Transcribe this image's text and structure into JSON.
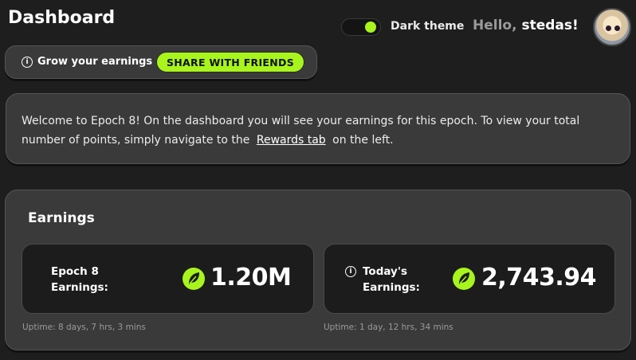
{
  "header": {
    "title": "Dashboard",
    "theme_label": "Dark theme",
    "theme_on": true,
    "greeting_hello": "Hello,",
    "greeting_user": "stedas!"
  },
  "grow": {
    "label": "Grow your earnings",
    "share_button": "SHARE WITH FRIENDS",
    "info_icon": "info-icon"
  },
  "welcome": {
    "text_before": "Welcome to Epoch 8! On the dashboard you will see your earnings for this epoch. To view your total number of points, simply navigate to the",
    "link_text": "Rewards tab",
    "text_after": "on the left."
  },
  "earnings": {
    "title": "Earnings",
    "epoch": {
      "label_line1": "Epoch 8",
      "label_line2": "Earnings:",
      "value": "1.20M",
      "uptime": "Uptime: 8 days, 7 hrs, 3 mins"
    },
    "today": {
      "label_line1": "Today's",
      "label_line2": "Earnings:",
      "value": "2,743.94",
      "uptime": "Uptime: 1 day, 12 hrs, 34 mins"
    }
  },
  "colors": {
    "accent": "#a8f41d",
    "background": "#1e1e1e",
    "card": "#3a3a3a",
    "stat_card": "#1c1c1c"
  }
}
